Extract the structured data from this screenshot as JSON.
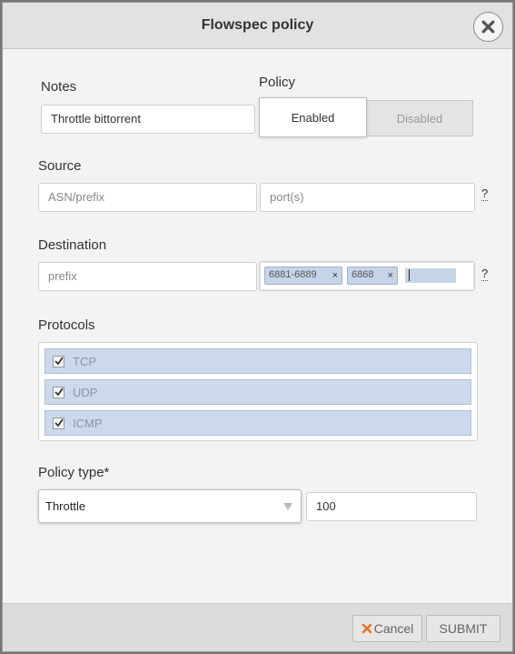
{
  "dialog": {
    "title": "Flowspec policy",
    "close_icon": "close-icon"
  },
  "notes": {
    "label": "Notes",
    "value": "Throttle bittorrent"
  },
  "policy": {
    "label": "Policy",
    "enabled_label": "Enabled",
    "disabled_label": "Disabled",
    "selected": "Enabled"
  },
  "source": {
    "label": "Source",
    "prefix_placeholder": "ASN/prefix",
    "ports_placeholder": "port(s)",
    "help": "?"
  },
  "destination": {
    "label": "Destination",
    "prefix_placeholder": "prefix",
    "ports": [
      {
        "label": "6881-6889",
        "remove": "×"
      },
      {
        "label": "6868",
        "remove": "×"
      }
    ],
    "help": "?"
  },
  "protocols": {
    "label": "Protocols",
    "items": [
      {
        "label": "TCP",
        "checked": true
      },
      {
        "label": "UDP",
        "checked": true
      },
      {
        "label": "ICMP",
        "checked": true
      }
    ]
  },
  "policy_type": {
    "label": "Policy type*",
    "selected": "Throttle",
    "rate_value": "100"
  },
  "footer": {
    "cancel_label": "Cancel",
    "submit_label": "SUBMIT"
  },
  "colors": {
    "accent_cancel": "#f07020",
    "tag_bg": "#c6d4e8",
    "protocol_bg": "#ccd9ec"
  }
}
